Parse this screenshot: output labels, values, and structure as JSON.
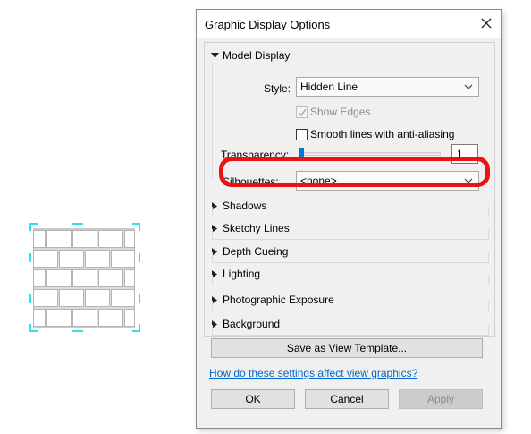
{
  "dialog": {
    "title": "Graphic Display Options",
    "close_icon": "close-icon"
  },
  "model_display": {
    "heading": "Model Display",
    "expanded": true,
    "style_label": "Style:",
    "style_value": "Hidden Line",
    "show_edges_label": "Show Edges",
    "show_edges_checked": true,
    "show_edges_enabled": false,
    "smooth_lines_label": "Smooth lines with anti-aliasing",
    "smooth_lines_checked": false,
    "transparency_label": "Transparency:",
    "transparency_value": "1",
    "silhouettes_label": "Silhouettes:",
    "silhouettes_value": "<none>"
  },
  "sections": [
    {
      "label": "Shadows",
      "expanded": false
    },
    {
      "label": "Sketchy Lines",
      "expanded": false
    },
    {
      "label": "Depth Cueing",
      "expanded": false
    },
    {
      "label": "Lighting",
      "expanded": false
    },
    {
      "label": "Photographic Exposure",
      "expanded": false
    },
    {
      "label": "Background",
      "expanded": false
    }
  ],
  "buttons": {
    "save_template": "Save as View Template...",
    "ok": "OK",
    "cancel": "Cancel",
    "apply": "Apply"
  },
  "help_link": "How do these settings affect view graphics?",
  "colors": {
    "annotation": "#ee1111",
    "crop_corners": "#37e0e0",
    "slider_thumb": "#0078d7",
    "link": "#0066cc"
  }
}
